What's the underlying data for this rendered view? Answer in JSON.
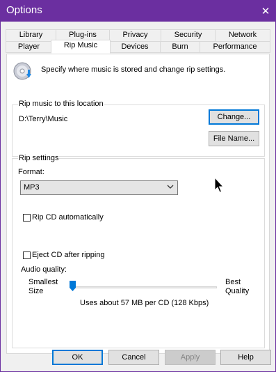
{
  "window": {
    "title": "Options",
    "close_glyph": "✕"
  },
  "tabs": {
    "row_back": [
      "Library",
      "Plug-ins",
      "Privacy",
      "Security",
      "Network"
    ],
    "row_front": [
      "Player",
      "Rip Music",
      "Devices",
      "Burn",
      "Performance"
    ],
    "active": "Rip Music"
  },
  "header": {
    "icon": "cd-rip-icon",
    "text": "Specify where music is stored and change rip settings."
  },
  "location": {
    "group_title": "Rip music to this location",
    "path": "D:\\Terry\\Music",
    "change_label": "Change...",
    "filename_label": "File Name..."
  },
  "rip_settings": {
    "group_title": "Rip settings",
    "format_label": "Format:",
    "format_value": "MP3",
    "rip_cd_auto_label": "Rip CD automatically",
    "rip_cd_auto_checked": false,
    "eject_label": "Eject CD after ripping",
    "eject_checked": false,
    "audio_quality_label": "Audio quality:",
    "smallest_line1": "Smallest",
    "smallest_line2": "Size",
    "best_line1": "Best",
    "best_line2": "Quality",
    "quality_level": 0,
    "usage_text": "Uses about 57 MB per CD (128 Kbps)"
  },
  "footer": {
    "ok_label": "OK",
    "cancel_label": "Cancel",
    "apply_label": "Apply",
    "help_label": "Help"
  },
  "colors": {
    "titlebar": "#6b2fa0",
    "accent": "#0078d7"
  }
}
